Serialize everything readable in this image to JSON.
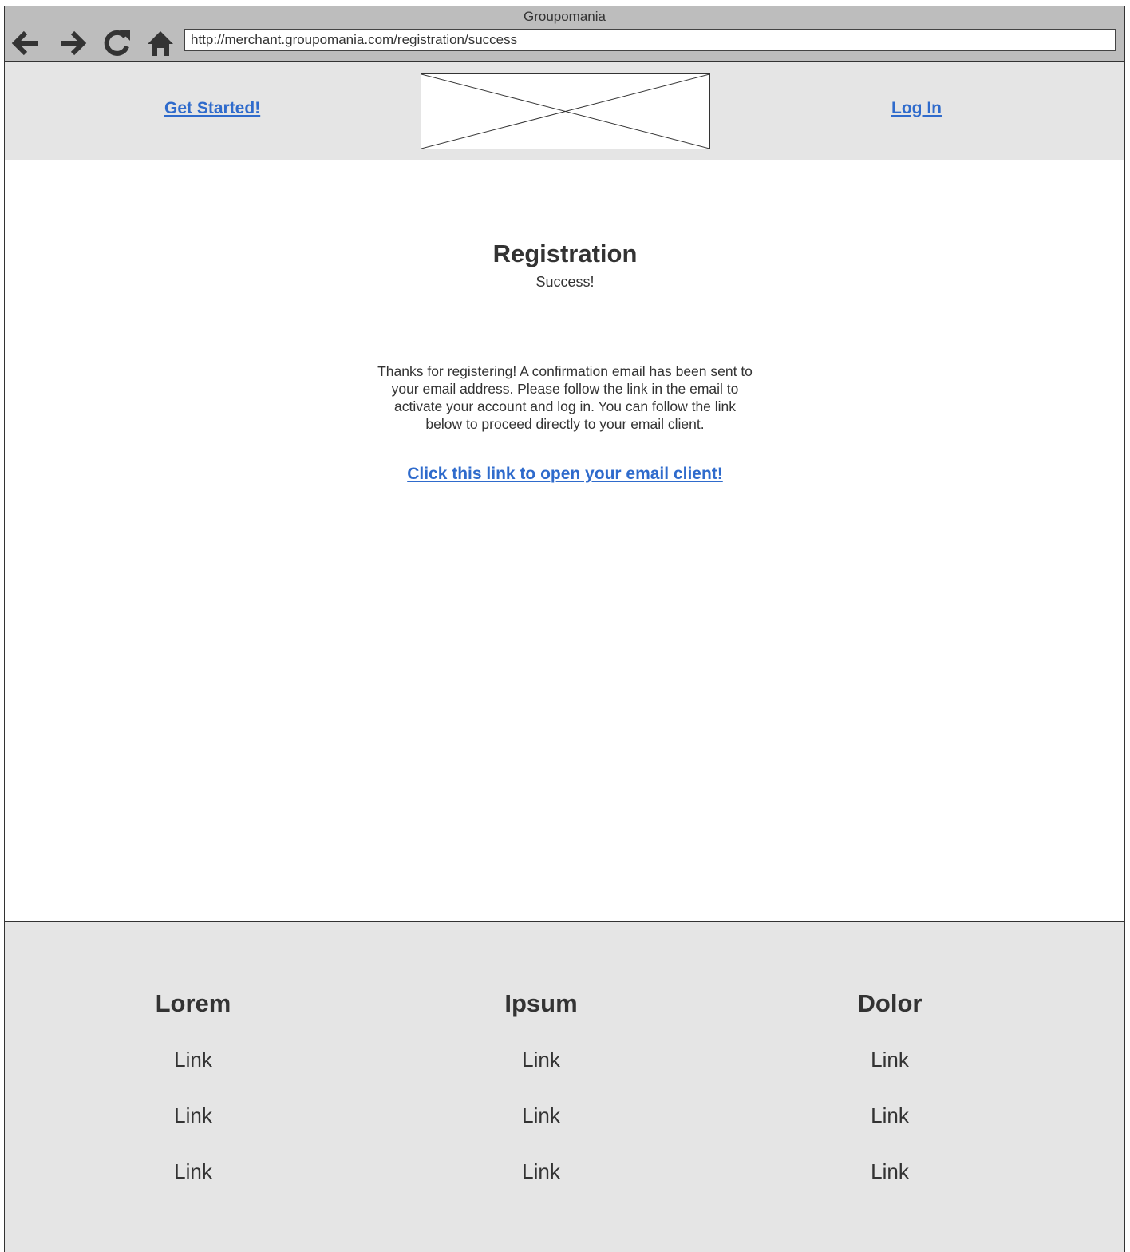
{
  "browser": {
    "title": "Groupomania",
    "url": "http://merchant.groupomania.com/registration/success"
  },
  "header": {
    "get_started": "Get Started!",
    "log_in": "Log In"
  },
  "main": {
    "title": "Registration",
    "subtitle": "Success!",
    "message": "Thanks for registering! A confirmation email has been sent to your email address. Please follow the link in the email to activate your account and log in. You can follow the link below to proceed directly to your email client.",
    "email_link": "Click this link to open your email client!"
  },
  "footer": {
    "columns": [
      {
        "heading": "Lorem",
        "links": [
          "Link",
          "Link",
          "Link"
        ]
      },
      {
        "heading": "Ipsum",
        "links": [
          "Link",
          "Link",
          "Link"
        ]
      },
      {
        "heading": "Dolor",
        "links": [
          "Link",
          "Link",
          "Link"
        ]
      }
    ]
  },
  "colors": {
    "link": "#2f6bcc",
    "chrome": "#bdbdbd",
    "panel": "#e5e5e5",
    "text": "#333333"
  }
}
